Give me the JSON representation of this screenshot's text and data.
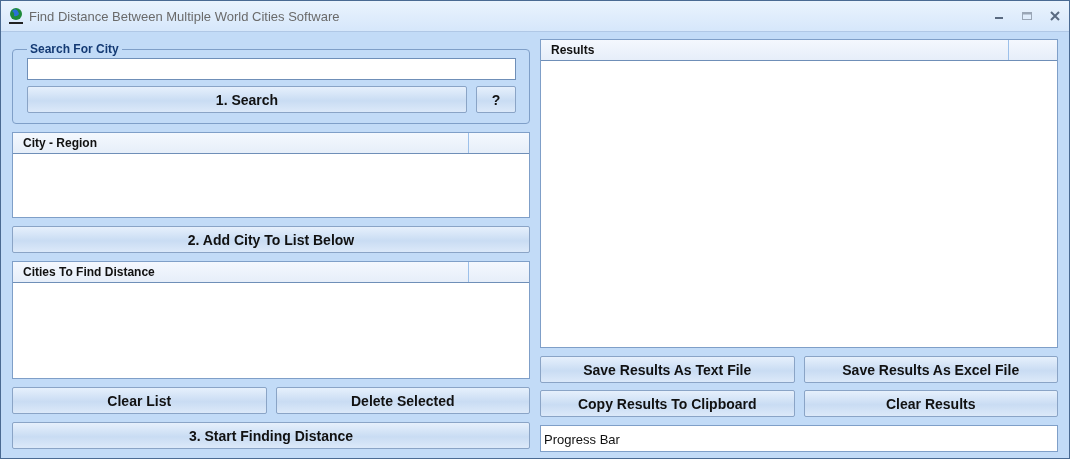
{
  "window": {
    "title": "Find Distance Between Multiple World Cities Software"
  },
  "search_group": {
    "legend": "Search For City",
    "search_button": "1. Search",
    "help_button": "?"
  },
  "city_list": {
    "columns": [
      "City - Region"
    ]
  },
  "add_button": "2. Add City To List Below",
  "cities_list": {
    "columns": [
      "Cities To Find Distance"
    ]
  },
  "list_buttons": [
    "Clear List",
    "Delete Selected"
  ],
  "start_button": "3. Start Finding Distance",
  "results_list": {
    "columns": [
      "Results"
    ]
  },
  "results_buttons": [
    "Save Results As Text File",
    "Save Results As Excel File",
    "Copy Results To Clipboard",
    "Clear Results"
  ],
  "progress_bar": {
    "label": "Progress Bar"
  }
}
